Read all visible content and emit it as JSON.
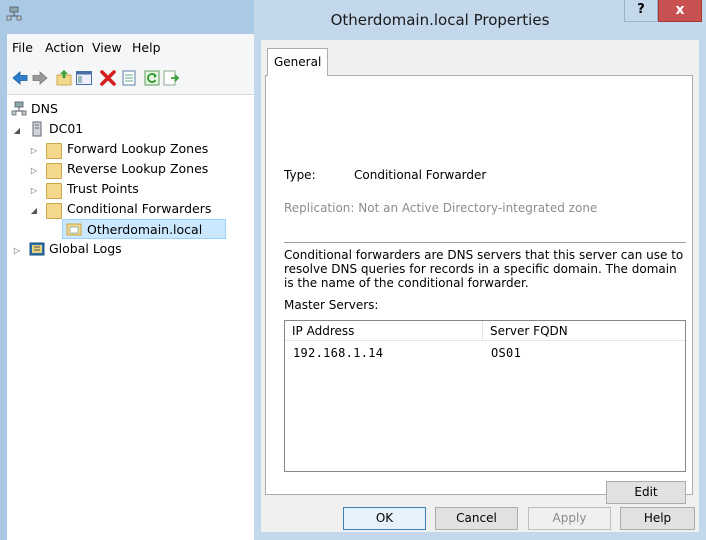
{
  "mmc": {
    "menu": [
      "File",
      "Action",
      "View",
      "Help"
    ],
    "toolbar_icons": [
      "back-arrow-icon",
      "forward-arrow-icon",
      "up-folder-icon",
      "show-hide-tree-icon",
      "delete-icon",
      "properties-icon",
      "refresh-icon",
      "export-list-icon"
    ],
    "tree": {
      "root": "DNS",
      "server": "DC01",
      "items": [
        {
          "label": "Forward Lookup Zones",
          "expander": "collapsed"
        },
        {
          "label": "Reverse Lookup Zones",
          "expander": "collapsed"
        },
        {
          "label": "Trust Points",
          "expander": "collapsed"
        },
        {
          "label": "Conditional Forwarders",
          "expander": "expanded"
        },
        {
          "label": "Otherdomain.local",
          "selected": true
        },
        {
          "label": "Global Logs",
          "expander": "collapsed"
        }
      ]
    }
  },
  "dialog": {
    "title": "Otherdomain.local Properties",
    "help_label": "?",
    "close_label": "x",
    "tab": "General",
    "type_label": "Type:",
    "type_value": "Conditional Forwarder",
    "replication": "Replication:  Not an Active Directory-integrated zone",
    "description": "Conditional forwarders are DNS servers that this server can use to resolve DNS queries for records in a specific domain.  The domain is the name of the conditional forwarder.",
    "master_servers_label": "Master Servers:",
    "columns": [
      "IP Address",
      "Server FQDN"
    ],
    "rows": [
      {
        "ip": "192.168.1.14",
        "fqdn": "OS01"
      }
    ],
    "edit_label": "Edit",
    "buttons": {
      "ok": "OK",
      "cancel": "Cancel",
      "apply": "Apply",
      "help": "Help"
    }
  },
  "colors": {
    "title_bar": "#c4d8ec",
    "close_button": "#c75050",
    "selection": "#cce8ff"
  }
}
